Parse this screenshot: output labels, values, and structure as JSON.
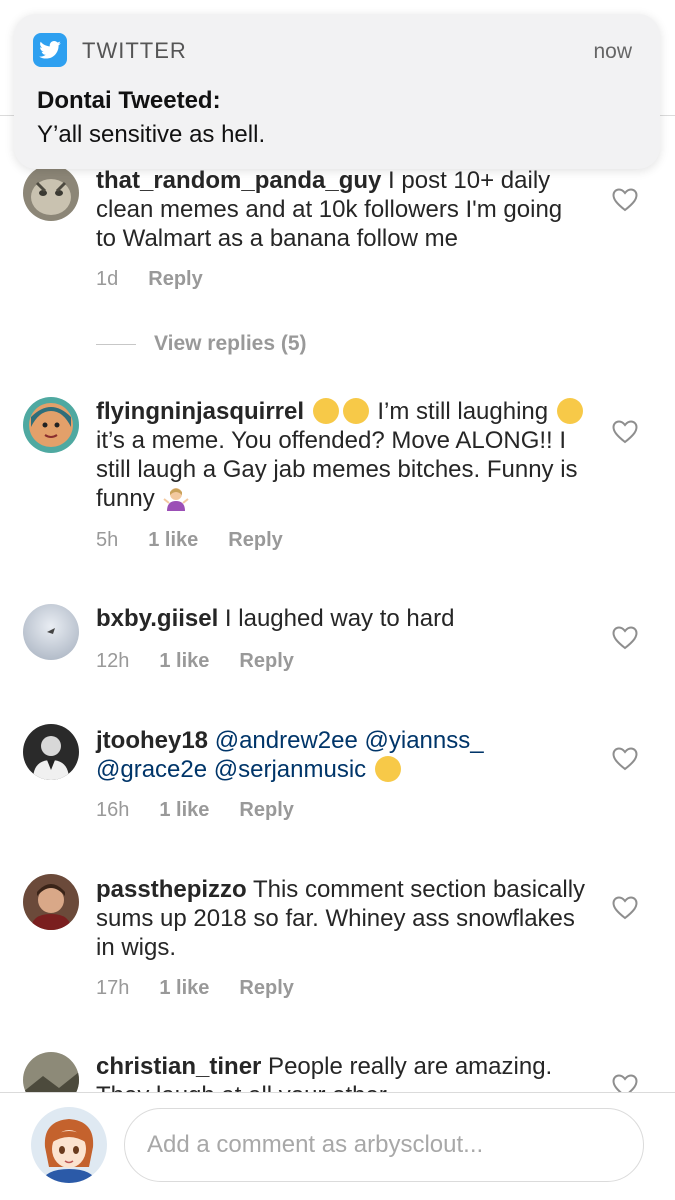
{
  "notification": {
    "app": "TWITTER",
    "time": "now",
    "title": "Dontai Tweeted:",
    "body": "Y’all sensitive as hell."
  },
  "comments": [
    {
      "username": "that_random_panda_guy",
      "text": " I post 10+ daily clean memes and at 10k followers I'm going to Walmart as a banana follow me",
      "time": "1d",
      "reply": "Reply",
      "view_replies": "View replies (5)"
    },
    {
      "username": "flyingninjasquirrel",
      "text_a": " I’m still laughing",
      "text_b": " it’s a meme.  You offended? Move ALONG!! I still laugh a Gay jab memes bitches. Funny is funny",
      "time": "5h",
      "likes": "1 like",
      "reply": "Reply"
    },
    {
      "username": "bxby.giisel",
      "text": " I laughed way to hard",
      "time": "12h",
      "likes": "1 like",
      "reply": "Reply"
    },
    {
      "username": "jtoohey18",
      "mentions": [
        "@andrew2ee",
        "@yiannss_",
        "@grace2e",
        "@serjanmusic"
      ],
      "time": "16h",
      "likes": "1 like",
      "reply": "Reply"
    },
    {
      "username": "passthepizzo",
      "text": " This comment section basically sums up 2018 so far. Whiney ass snowflakes in wigs.",
      "time": "17h",
      "likes": "1 like",
      "reply": "Reply"
    },
    {
      "username": "christian_tiner",
      "text": " People really are amazing. They laugh at all your other"
    }
  ],
  "comment_box": {
    "placeholder": "Add a comment as arbysclout..."
  },
  "colors": {
    "twitter_blue": "#2ea0f0",
    "mention": "#003569",
    "meta_gray": "#999999"
  }
}
